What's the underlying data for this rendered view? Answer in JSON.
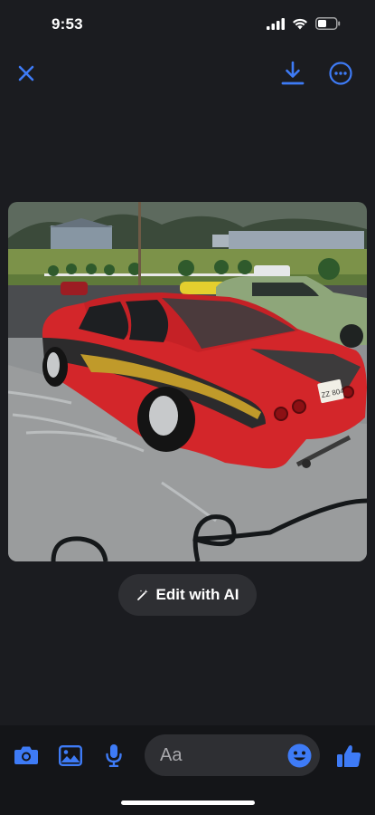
{
  "status_bar": {
    "time": "9:53"
  },
  "toolbar": {
    "close_icon": "close-icon",
    "download_icon": "download-icon",
    "more_icon": "more-options-icon"
  },
  "photo": {
    "description_icon": "photo",
    "plate_text": "ZZ 804"
  },
  "ai_chip": {
    "label": "Edit with AI",
    "icon": "magic-wand-icon"
  },
  "composer": {
    "placeholder": "Aa",
    "icons": [
      "camera-icon",
      "gallery-icon",
      "microphone-icon",
      "emoji-icon",
      "thumbs-up-icon"
    ]
  },
  "colors": {
    "accent": "#3e7bf6",
    "background": "#1b1c20"
  }
}
